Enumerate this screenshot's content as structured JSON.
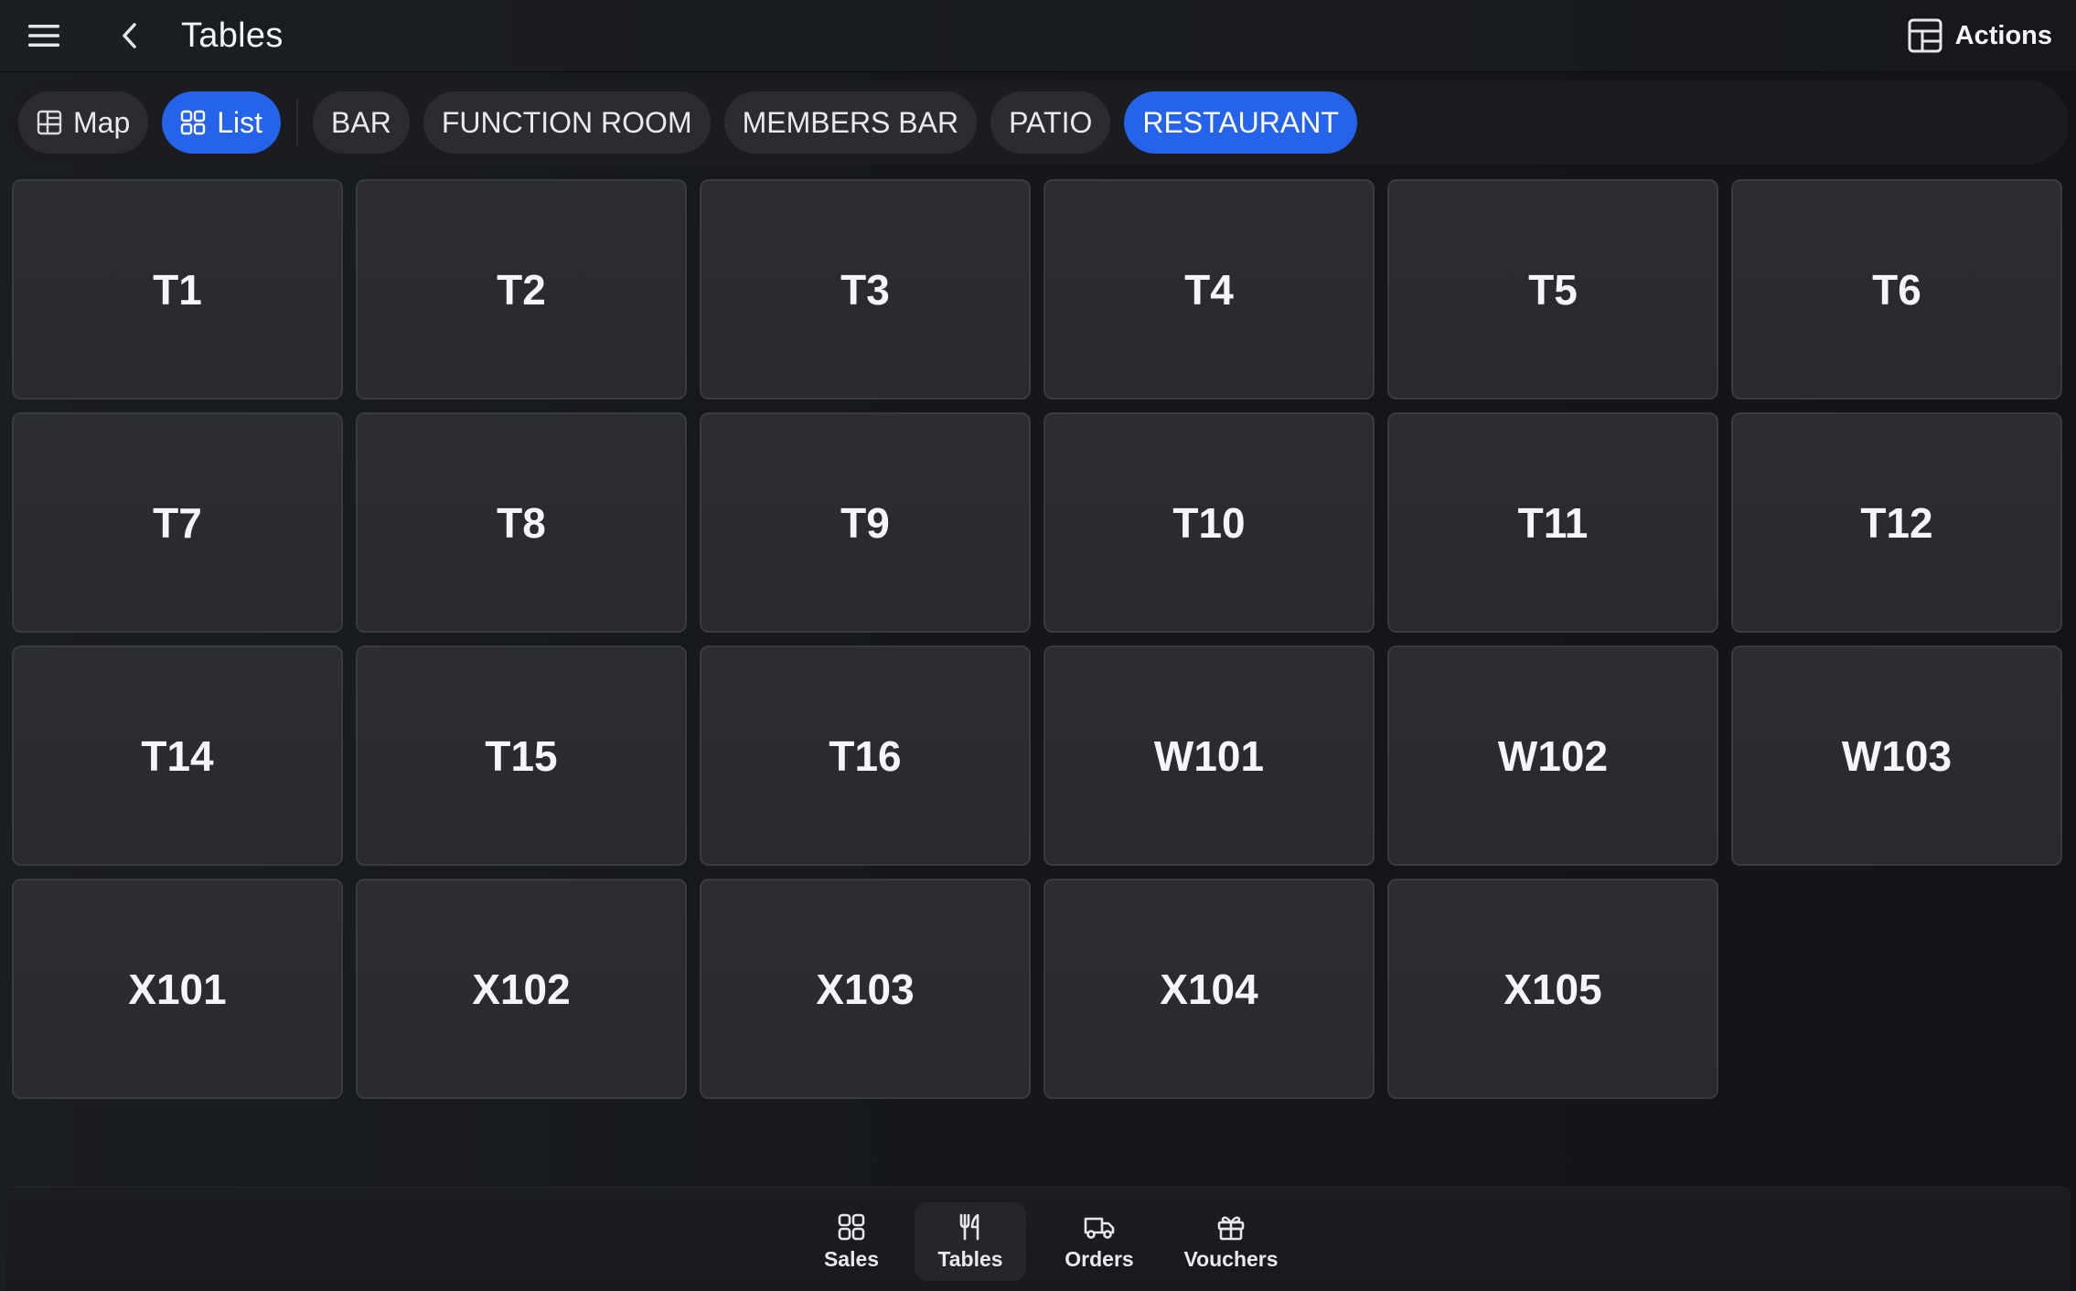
{
  "header": {
    "title": "Tables",
    "menu_icon": "menu-icon",
    "back_icon": "chevron-left-icon",
    "actions_label": "Actions",
    "actions_icon": "layout-icon"
  },
  "view_toggle": {
    "map_label": "Map",
    "list_label": "List",
    "selected": "List"
  },
  "areas": [
    {
      "label": "BAR",
      "active": false
    },
    {
      "label": "FUNCTION ROOM",
      "active": false
    },
    {
      "label": "MEMBERS BAR",
      "active": false
    },
    {
      "label": "PATIO",
      "active": false
    },
    {
      "label": "RESTAURANT",
      "active": true
    }
  ],
  "tables": [
    "T1",
    "T2",
    "T3",
    "T4",
    "T5",
    "T6",
    "T7",
    "T8",
    "T9",
    "T10",
    "T11",
    "T12",
    "T14",
    "T15",
    "T16",
    "W101",
    "W102",
    "W103",
    "X101",
    "X102",
    "X103",
    "X104",
    "X105"
  ],
  "bottom_nav": [
    {
      "label": "Sales",
      "icon": "grid-icon",
      "active": false
    },
    {
      "label": "Tables",
      "icon": "utensils-icon",
      "active": true
    },
    {
      "label": "Orders",
      "icon": "truck-icon",
      "active": false
    },
    {
      "label": "Vouchers",
      "icon": "gift-icon",
      "active": false
    }
  ],
  "colors": {
    "accent": "#2563eb",
    "background": "#121417",
    "tile": "#2c2d32",
    "pill": "#2a2c31"
  }
}
